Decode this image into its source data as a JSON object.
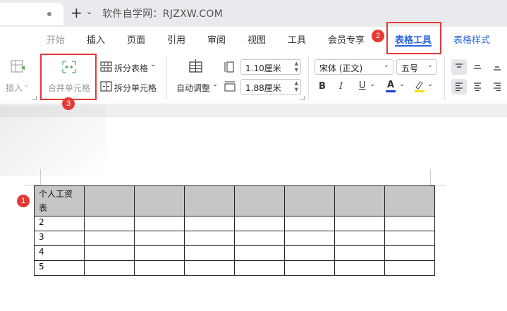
{
  "titlebar": {
    "new_tab_symbol": "+",
    "dropdown_symbol": "⌄",
    "watermark": "软件自学网：RJZXW.COM"
  },
  "menu": {
    "items": [
      "开始",
      "插入",
      "页面",
      "引用",
      "审阅",
      "视图",
      "工具",
      "会员专享",
      "表格工具",
      "表格样式"
    ],
    "active": "表格工具"
  },
  "ribbon": {
    "insert_label": "插入",
    "merge_label": "合并单元格",
    "split_table_label": "拆分表格",
    "split_cell_label": "拆分单元格",
    "autofit_label": "自动调整",
    "row_height_value": "1.10厘米",
    "col_width_value": "1.88厘米",
    "font_name": "宋体 (正文)",
    "font_size": "五号",
    "bold": "B",
    "italic": "I",
    "underline": "U",
    "font_color_letter": "A",
    "font_color": "#1a3fd6",
    "highlight_color": "#f5e000"
  },
  "annotations": {
    "badge_1": "1",
    "badge_2": "2",
    "badge_3": "3",
    "color": "#e53935"
  },
  "table": {
    "header_first_cell": "个人工资表",
    "header_first_cell_line1": "个人工资",
    "header_first_cell_line2": "表",
    "rows": [
      "2",
      "3",
      "4",
      "5"
    ],
    "columns": 8,
    "header_fill": "#c6c6c6"
  }
}
